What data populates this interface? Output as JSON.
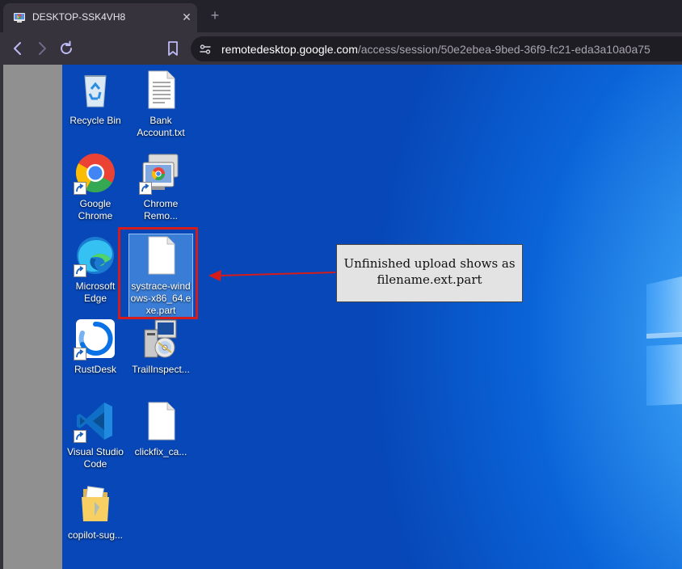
{
  "browser": {
    "tab_title": "DESKTOP-SSK4VH8",
    "tab_close": "✕",
    "new_tab": "+",
    "url_host": "remotedesktop.google.com",
    "url_path": "/access/session/50e2ebea-9bed-36f9-fc21-eda3a10a0a75"
  },
  "desktop": {
    "icons": [
      {
        "label": "Recycle Bin"
      },
      {
        "label": "Bank\nAccount.txt"
      },
      {
        "label": "Google\nChrome"
      },
      {
        "label": "Chrome\nRemo..."
      },
      {
        "label": "Microsoft\nEdge"
      },
      {
        "label": "systrace-wind\nows-x86_64.e\nxe.part"
      },
      {
        "label": "RustDesk"
      },
      {
        "label": "TrailInspect..."
      },
      {
        "label": "Visual Studio\nCode"
      },
      {
        "label": "clickfix_ca..."
      },
      {
        "label": "copilot-sug..."
      }
    ]
  },
  "annotation": {
    "callout_line1": "Unfinished upload shows as",
    "callout_line2": "filename.ext.part"
  }
}
